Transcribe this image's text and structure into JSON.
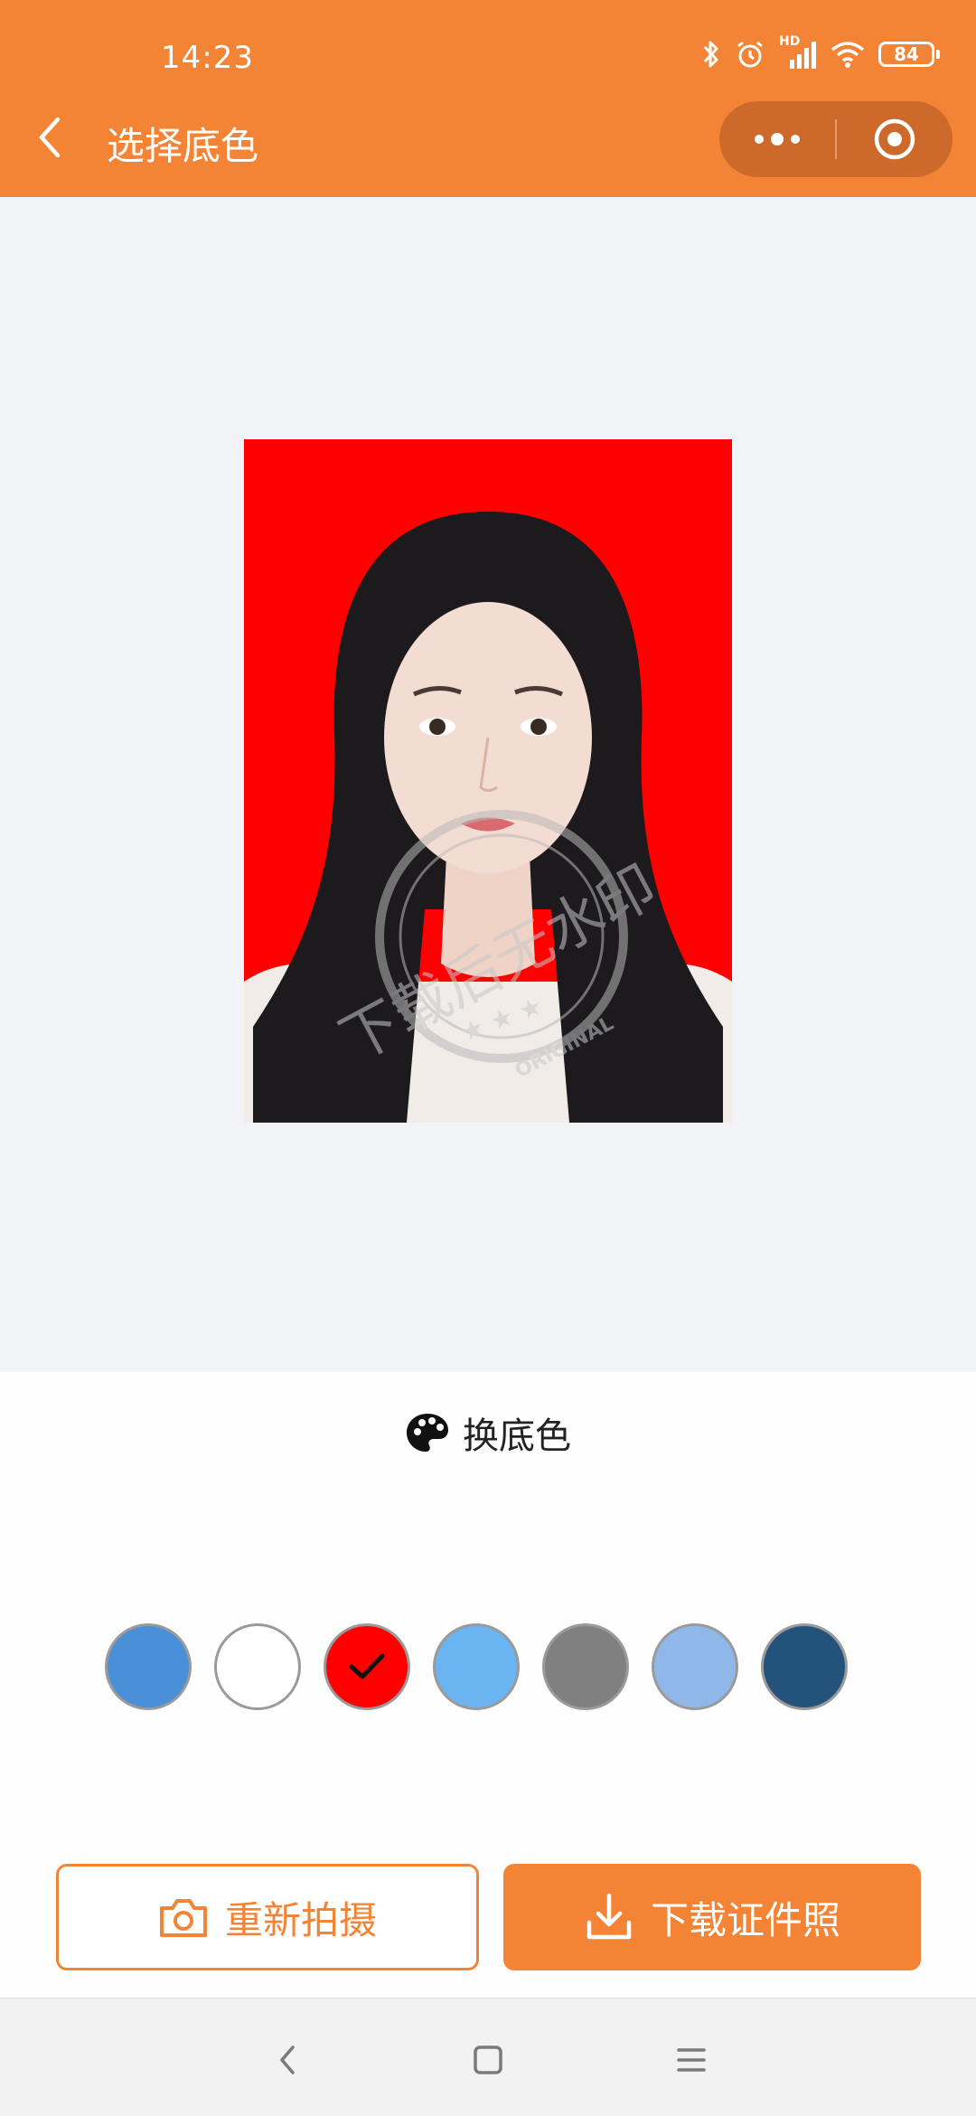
{
  "status_bar": {
    "time": "14:23",
    "battery": "84",
    "signal_label": "HD",
    "icons": [
      "bluetooth-icon",
      "alarm-icon",
      "signal-icon",
      "wifi-icon",
      "battery-icon"
    ]
  },
  "header": {
    "title": "选择底色",
    "back_icon": "chevron-left-icon",
    "capsule": {
      "more_icon": "more-dots-icon",
      "close_icon": "target-close-icon"
    }
  },
  "photo": {
    "background_color": "#ff0000",
    "watermark_top": "下载后无水印",
    "watermark_bottom": "ORIGINAL"
  },
  "color_section": {
    "title": "换底色",
    "icon": "palette-icon"
  },
  "swatches": [
    {
      "name": "blue",
      "color": "#4a90d9",
      "selected": false
    },
    {
      "name": "white",
      "color": "#ffffff",
      "selected": false
    },
    {
      "name": "red",
      "color": "#ff0000",
      "selected": true
    },
    {
      "name": "light-blue",
      "color": "#6bb4f2",
      "selected": false
    },
    {
      "name": "gray",
      "color": "#808080",
      "selected": false
    },
    {
      "name": "pale-blue",
      "color": "#8fb8e8",
      "selected": false
    },
    {
      "name": "dark-blue",
      "color": "#23527a",
      "selected": false
    }
  ],
  "buttons": {
    "retake": "重新拍摄",
    "download": "下载证件照"
  },
  "colors": {
    "accent": "#f48435",
    "capsule": "#cd6a2b",
    "page_bg": "#f2f3f7"
  }
}
